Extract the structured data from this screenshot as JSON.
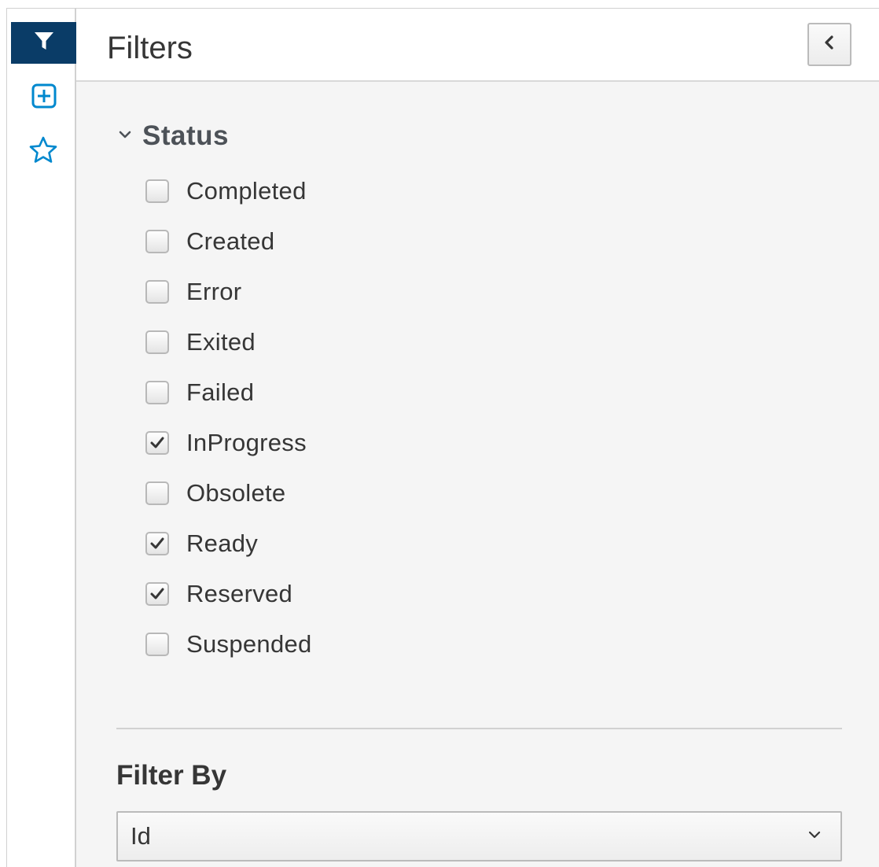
{
  "rail": {
    "items": [
      {
        "icon": "filter-icon",
        "active": true
      },
      {
        "icon": "plus-square-icon",
        "active": false
      },
      {
        "icon": "star-icon",
        "active": false
      }
    ]
  },
  "panel": {
    "title": "Filters",
    "collapse_icon": "chevron-left-icon"
  },
  "status_section": {
    "title": "Status",
    "expanded": true,
    "items": [
      {
        "label": "Completed",
        "checked": false
      },
      {
        "label": "Created",
        "checked": false
      },
      {
        "label": "Error",
        "checked": false
      },
      {
        "label": "Exited",
        "checked": false
      },
      {
        "label": "Failed",
        "checked": false
      },
      {
        "label": "InProgress",
        "checked": true
      },
      {
        "label": "Obsolete",
        "checked": false
      },
      {
        "label": "Ready",
        "checked": true
      },
      {
        "label": "Reserved",
        "checked": true
      },
      {
        "label": "Suspended",
        "checked": false
      }
    ]
  },
  "filter_by": {
    "title": "Filter By",
    "selected": "Id"
  },
  "colors": {
    "active_rail": "#0a3c67",
    "icon_blue": "#0088ce",
    "panel_bg": "#f5f5f5",
    "text": "#363636"
  }
}
